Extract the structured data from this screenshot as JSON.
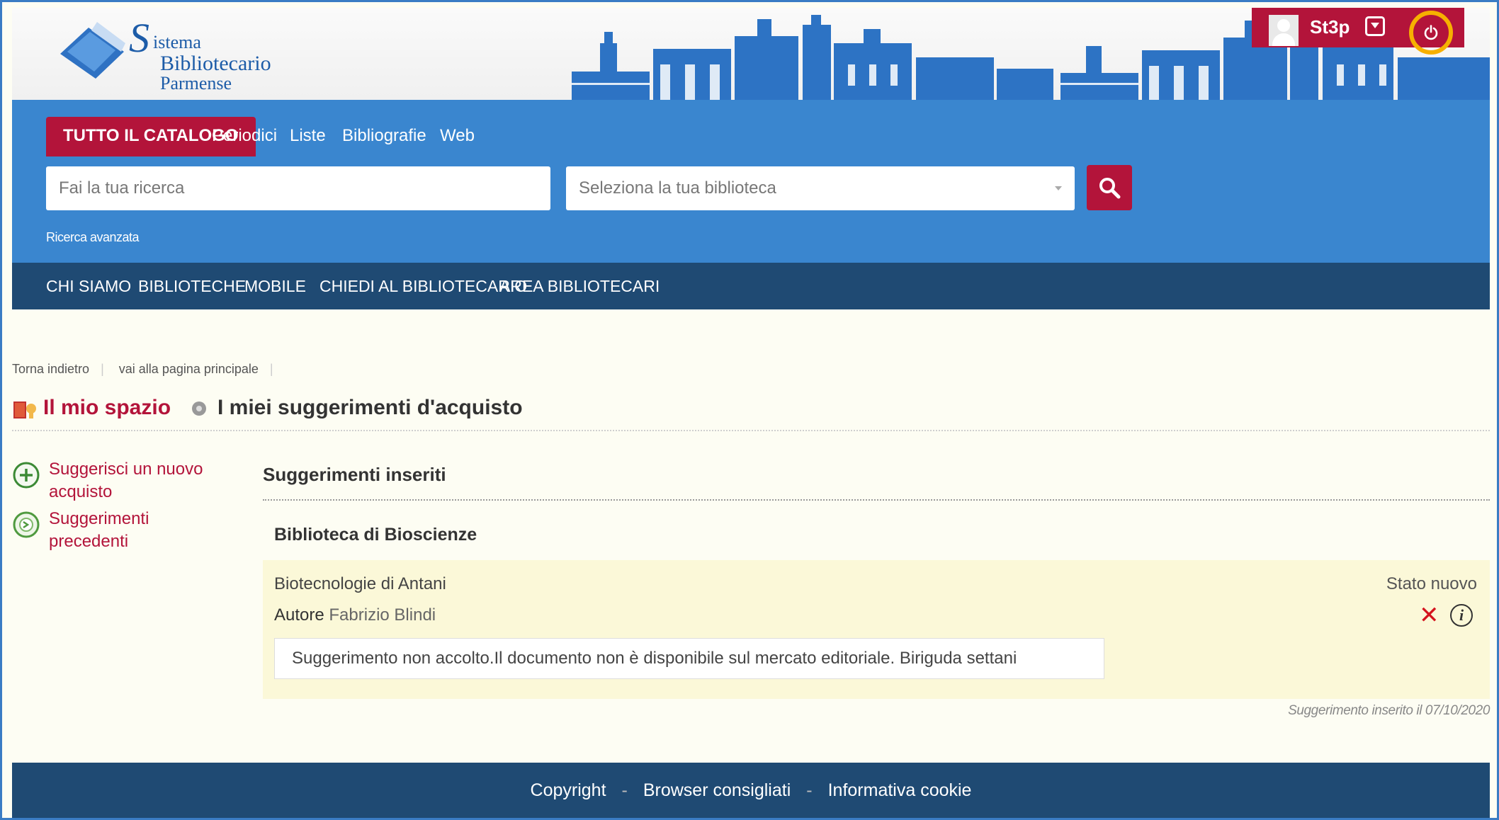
{
  "header": {
    "logo_lines": [
      "istema",
      "Bibliotecario",
      "Parmense"
    ],
    "logo_initial": "S",
    "user_name": "St3p",
    "icons": [
      "avatar",
      "chevron-down-icon",
      "power-icon"
    ]
  },
  "search": {
    "tabs": [
      "TUTTO IL CATALOGO",
      "Periodici",
      "Liste",
      "Bibliografie",
      "Web"
    ],
    "query_placeholder": "Fai la tua ricerca",
    "library_placeholder": "Seleziona la tua biblioteca",
    "advanced_link": "Ricerca avanzata"
  },
  "nav": [
    "CHI SIAMO",
    "BIBLIOTECHE",
    "MOBILE",
    "CHIEDI AL BIBLIOTECARIO",
    "AREA BIBLIOTECARI"
  ],
  "breadcrumb": [
    "Torna indietro",
    "vai alla pagina principale"
  ],
  "page": {
    "section_root": "Il mio spazio",
    "title": "I miei suggerimenti d'acquisto"
  },
  "sidebar": [
    {
      "label": "Suggerisci un nuovo acquisto",
      "icon": "plus-circle-icon"
    },
    {
      "label": "Suggerimenti precedenti",
      "icon": "history-icon"
    }
  ],
  "main": {
    "section_title": "Suggerimenti inseriti",
    "library": "Biblioteca di Bioscienze",
    "item": {
      "title": "Biotecnologie di Antani",
      "author_label": "Autore",
      "author": "Fabrizio Blindi",
      "state": "Stato nuovo",
      "note": "Suggerimento non accolto.Il documento non è disponibile sul mercato editoriale. Biriguda settani",
      "delete_symbol": "✕",
      "info_symbol": "i"
    },
    "inserted": "Suggerimento inserito il 07/10/2020"
  },
  "footer": [
    "Copyright",
    "Browser consigliati",
    "Informativa cookie"
  ],
  "colors": {
    "brand_red": "#b3143a",
    "blue": "#3a86cf",
    "navy": "#1f4a73",
    "highlight": "#f6b000"
  }
}
